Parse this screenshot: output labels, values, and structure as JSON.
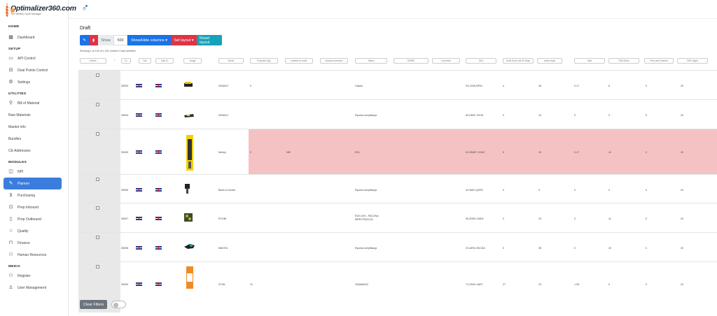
{
  "logo": {
    "brand": "Optimalizer360.com",
    "tagline": "The Weekly Cycle Manager"
  },
  "sidebar": {
    "sections": [
      {
        "title": "HOME",
        "items": [
          {
            "label": "Dashboard",
            "icon": "grid-icon"
          }
        ]
      },
      {
        "title": "SETUP",
        "items": [
          {
            "label": "API Control",
            "icon": "monitor-icon"
          },
          {
            "label": "Deal Points Control",
            "icon": "sliders-icon"
          },
          {
            "label": "Settings",
            "icon": "gear-icon"
          }
        ]
      },
      {
        "title": "UTILITIES",
        "items": [
          {
            "label": "Bill of Material",
            "icon": "magnifier-icon"
          },
          {
            "label": "Raw Materials",
            "icon": ""
          },
          {
            "label": "Market info",
            "icon": ""
          },
          {
            "label": "Bundles",
            "icon": ""
          },
          {
            "label": "CE Addresses",
            "icon": ""
          }
        ]
      },
      {
        "title": "MODULES",
        "items": [
          {
            "label": "NPI",
            "icon": "box-icon"
          },
          {
            "label": "Planner",
            "icon": "pencil-icon",
            "active": true
          },
          {
            "label": "Purchasing",
            "icon": "cart-icon"
          },
          {
            "label": "Prep Inbound",
            "icon": "truck-icon"
          },
          {
            "label": "Prep Outbound",
            "icon": "clipboard-icon"
          },
          {
            "label": "Quality",
            "icon": "star-icon"
          },
          {
            "label": "Finance",
            "icon": "bag-icon"
          },
          {
            "label": "Human Resources",
            "icon": "users-icon"
          }
        ]
      },
      {
        "title": "MEDIA",
        "items": [
          {
            "label": "Register",
            "icon": "user-plus-icon"
          },
          {
            "label": "User Management",
            "icon": "user-icon"
          }
        ]
      }
    ]
  },
  "card": {
    "title": "Draft"
  },
  "toolbar": {
    "show_label": "Show",
    "show_value": "500",
    "columns_label": "Show/Hide columns ▾",
    "layout_label": "Set layout ▾",
    "reset_label": "Reset layout"
  },
  "info": "Showing 1 to 100 of 1,321 entries   0 rows selected",
  "table": {
    "headers": [
      "-- Select --",
      "↑",
      "ID",
      "Sell",
      "Ship To",
      "Image",
      "Brand",
      "Proposed Qty",
      "whether to order",
      "manual correction",
      "Status",
      "SPARE",
      "Comment",
      "SKU",
      "Units Sold Last 30 Days",
      "Active days",
      "Sale",
      "FBA Stock",
      "Prep and Ordered",
      "FBA Target"
    ],
    "rows": [
      {
        "id": "35093",
        "brand": "DEWALT",
        "qty": "0",
        "order": "",
        "status": "Całość",
        "sku": "R3-JX06-NP91",
        "sold": "4",
        "days": "26",
        "sale": "0.17",
        "stock": "6",
        "prep": "0",
        "target": "20"
      },
      {
        "id": "35094",
        "brand": "DEWALT",
        "qty": "",
        "order": "",
        "status": "Ręczna weryfikacja",
        "sku": "6V-KB3F-ZVHA",
        "sold": "0",
        "days": "19",
        "sale": "0",
        "stock": "0",
        "prep": "0",
        "target": "20"
      },
      {
        "id": "35095",
        "brand": "Merley",
        "qty": "0",
        "order": "NIE",
        "status": "EOL",
        "sku": "K2-EKMF-YZ442",
        "sold": "5",
        "days": "30",
        "sale": "0.17",
        "stock": "41",
        "prep": "0",
        "target": "20"
      },
      {
        "id": "35096",
        "brand": "Black & Decker",
        "qty": "",
        "order": "",
        "status": "Ręczna weryfikacja",
        "sku": "4I-H6DV-Q2PN",
        "sold": "0",
        "days": "9",
        "sale": "0",
        "stock": "0",
        "prep": "0",
        "target": "20"
      },
      {
        "id": "35097",
        "brand": "RYOBI",
        "qty": "",
        "order": "",
        "status": "ROI<10% - RĘCZNA WERYFIKACJA",
        "sku": "99-ZDEH-JMD4",
        "sold": "0",
        "days": "23",
        "sale": "0",
        "stock": "41",
        "prep": "0",
        "target": "20"
      },
      {
        "id": "35098",
        "brand": "MAKITA",
        "qty": "",
        "order": "",
        "status": "Ręczna weryfikacja",
        "sku": "ZX-AR0J-9KCDA",
        "sold": "0",
        "days": "28",
        "sale": "0",
        "stock": "20",
        "prep": "0",
        "target": "20"
      },
      {
        "id": "35099",
        "brand": "STIHL",
        "qty": "31",
        "order": "",
        "status": "ZAMAWIAĆ",
        "sku": "T1-PAXK-4AR7",
        "sold": "27",
        "days": "23",
        "sale": "1.08",
        "stock": "0",
        "prep": "0",
        "target": "20"
      }
    ]
  },
  "footer": {
    "clear_label": "Clear Filters"
  },
  "colors": {
    "primary": "#1a73e8",
    "danger": "#dc3545",
    "info": "#17a2b8",
    "highlight_row": "#f5c2c4",
    "active_nav": "#3b7ddd"
  }
}
